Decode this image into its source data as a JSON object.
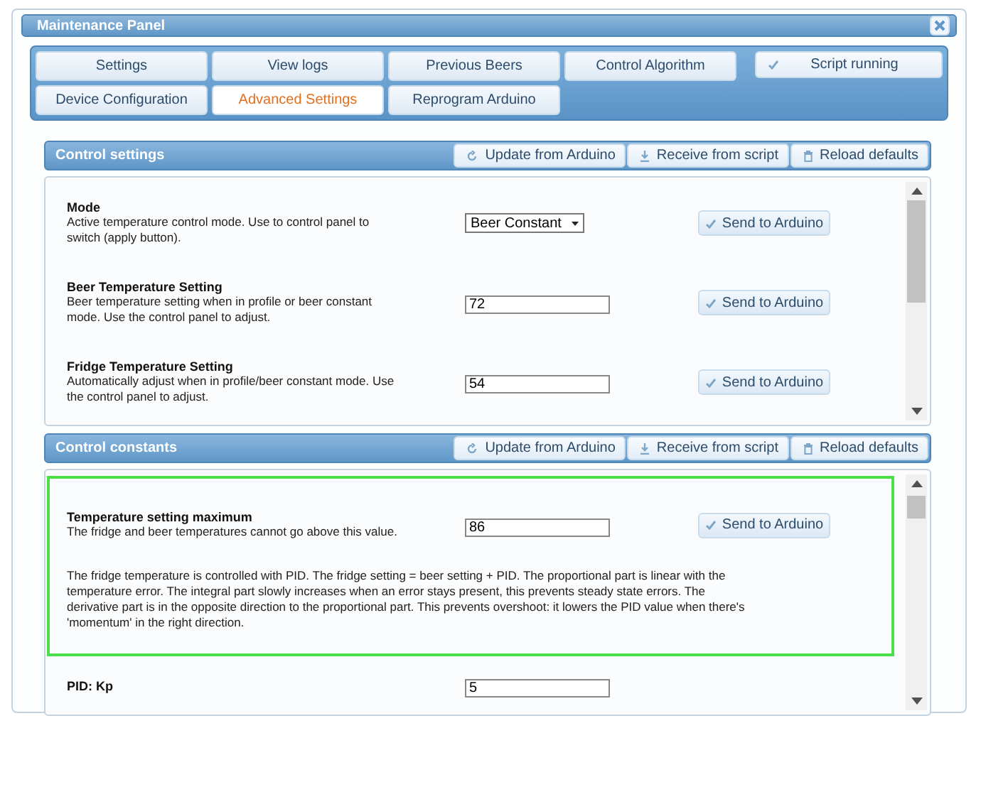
{
  "window": {
    "title": "Maintenance Panel"
  },
  "tabs": [
    {
      "label": "Settings",
      "selected": false
    },
    {
      "label": "View logs",
      "selected": false
    },
    {
      "label": "Previous Beers",
      "selected": false
    },
    {
      "label": "Control Algorithm",
      "selected": false
    },
    {
      "label": "Device Configuration",
      "selected": false
    },
    {
      "label": "Advanced Settings",
      "selected": true
    },
    {
      "label": "Reprogram Arduino",
      "selected": false
    }
  ],
  "script_status": {
    "label": "Script running",
    "checked": true
  },
  "sections": [
    {
      "title": "Control settings",
      "buttons": [
        "Update from Arduino",
        "Receive from script",
        "Reload defaults"
      ],
      "rows": [
        {
          "title": "Mode",
          "description": "Active temperature control mode. Use to control panel to switch (apply button).",
          "field": {
            "kind": "select",
            "value": "Beer Constant"
          },
          "button": "Send to Arduino",
          "highlighted": false
        },
        {
          "title": "Beer Temperature Setting",
          "description": "Beer temperature setting when in profile or beer constant mode. Use the control panel to adjust.",
          "field": {
            "kind": "text",
            "value": "72"
          },
          "button": "Send to Arduino",
          "highlighted": false
        },
        {
          "title": "Fridge Temperature Setting",
          "description": "Automatically adjust when in profile/beer constant mode. Use the control panel to adjust.",
          "field": {
            "kind": "text",
            "value": "54"
          },
          "button": "Send to Arduino",
          "highlighted": false
        }
      ]
    },
    {
      "title": "Control constants",
      "buttons": [
        "Update from Arduino",
        "Receive from script",
        "Reload defaults"
      ],
      "rows": [
        {
          "title": "Temperature setting maximum",
          "description": "The fridge and beer temperatures cannot go above this value.",
          "field": {
            "kind": "text",
            "value": "86"
          },
          "button": "Send to Arduino",
          "highlighted": true,
          "note": "The fridge temperature is controlled with PID. The fridge setting = beer setting + PID. The proportional part is linear with the temperature error. The integral part slowly increases when an error stays present, this prevents steady state errors. The derivative part is in the opposite direction to the proportional part. This prevents overshoot: it lowers the PID value when there's 'momentum' in the right direction."
        },
        {
          "title": "PID: Kp",
          "field": {
            "kind": "text",
            "value": "5"
          },
          "highlighted": false
        }
      ]
    }
  ]
}
